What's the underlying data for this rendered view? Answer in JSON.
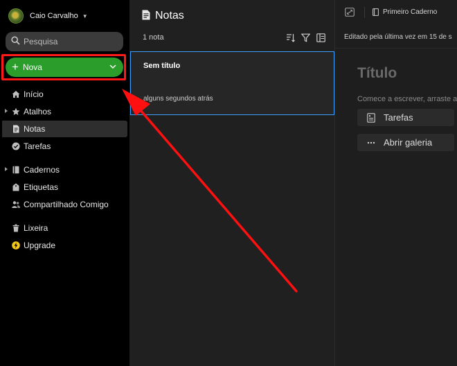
{
  "sidebar": {
    "account": {
      "name": "Caio Carvalho"
    },
    "search": {
      "placeholder": "Pesquisa"
    },
    "new_button": {
      "label": "Nova"
    },
    "nav": [
      {
        "label": "Início",
        "icon": "home-icon"
      },
      {
        "label": "Atalhos",
        "icon": "star-icon",
        "expandable": true
      },
      {
        "label": "Notas",
        "icon": "note-icon",
        "active": true
      },
      {
        "label": "Tarefas",
        "icon": "check-circle-icon"
      },
      {
        "label": "Cadernos",
        "icon": "notebook-icon",
        "expandable": true
      },
      {
        "label": "Etiquetas",
        "icon": "tag-icon"
      },
      {
        "label": "Compartilhado Comigo",
        "icon": "people-icon"
      },
      {
        "label": "Lixeira",
        "icon": "trash-icon"
      },
      {
        "label": "Upgrade",
        "icon": "lightning-icon"
      }
    ]
  },
  "notes_panel": {
    "title": "Notas",
    "count": "1 nota",
    "notes": [
      {
        "title": "Sem título",
        "time": "alguns segundos atrás"
      }
    ]
  },
  "editor": {
    "notebook": "Primeiro Caderno",
    "edited": "Editado pela última vez em 15 de s",
    "title_placeholder": "Título",
    "hint": "Comece a escrever, arraste a",
    "chips": [
      {
        "label": "Tarefas",
        "icon": "task-doc-icon"
      },
      {
        "label": "Abrir galeria",
        "icon": "more-icon"
      }
    ]
  },
  "colors": {
    "accent_green": "#2a9d2a",
    "highlight_red": "#ff1a1a",
    "selection_blue": "#3ba0ff",
    "upgrade_yellow": "#f5c518"
  }
}
